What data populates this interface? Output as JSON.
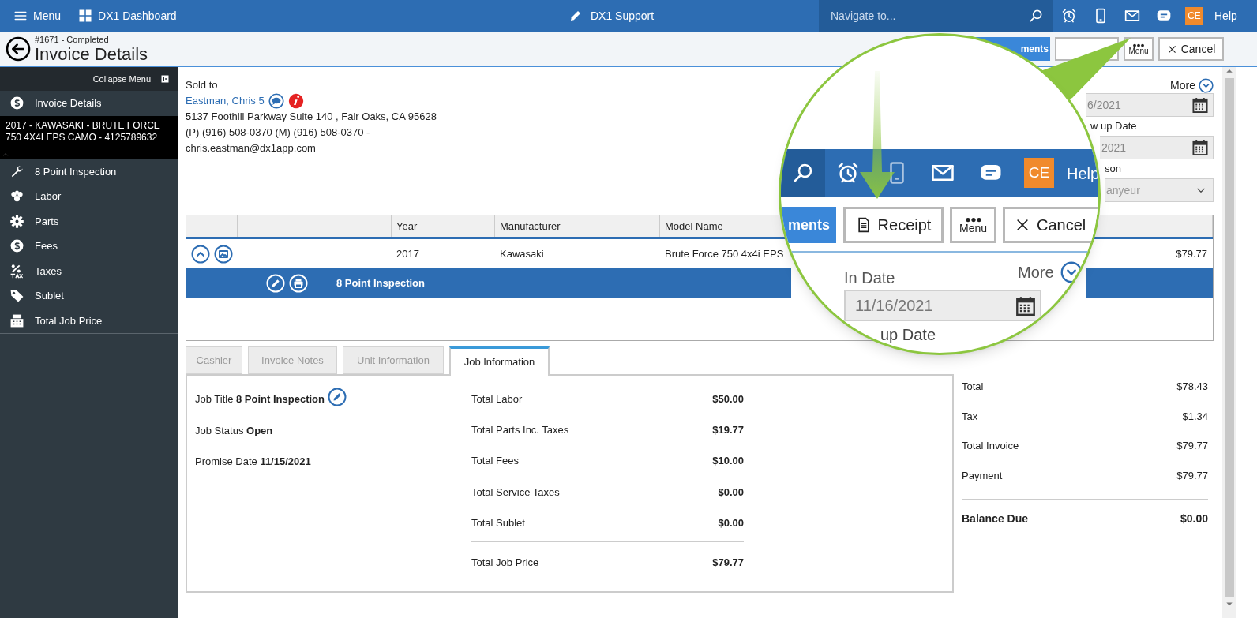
{
  "top_bar": {
    "menu_label": "Menu",
    "dashboard_label": "DX1 Dashboard",
    "center_title": "DX1 Support",
    "search": {
      "placeholder": "Navigate to..."
    },
    "avatar": "CE",
    "help": "Help"
  },
  "header": {
    "status": "#1671 - Completed",
    "title": "Invoice Details",
    "buttons": [
      {
        "kind": "primary",
        "label": "ments"
      },
      {
        "kind": "covered"
      },
      {
        "kind": "menu",
        "label": "Menu"
      },
      {
        "kind": "cancel",
        "label": "Cancel"
      }
    ]
  },
  "sidebar": {
    "collapse_label": "Collapse Menu",
    "items": [
      {
        "kind": "nav",
        "label": "Invoice Details"
      },
      {
        "kind": "unit",
        "label": "2017 - KAWASAKI - BRUTE FORCE 750 4X4I EPS CAMO - 4125789632"
      },
      {
        "kind": "nav",
        "label": "8 Point Inspection"
      },
      {
        "kind": "nav",
        "label": "Labor"
      },
      {
        "kind": "nav",
        "label": "Parts"
      },
      {
        "kind": "nav",
        "label": "Fees"
      },
      {
        "kind": "nav",
        "label": "Taxes"
      },
      {
        "kind": "nav",
        "label": "Sublet"
      },
      {
        "kind": "nav",
        "label": "Total Job Price"
      }
    ]
  },
  "sold_to": {
    "label": "Sold to",
    "customer": "Eastman, Chris 5",
    "address": "5137 Foothill Parkway Suite 140 , Fair Oaks, CA 95628",
    "phones": "(P) (916) 508-0370 (M) (916) 508-0370 -",
    "email": "chris.eastman@dx1app.com"
  },
  "details_panel": {
    "more": "More",
    "fields": [
      {
        "kind": "date",
        "value": "6/2021"
      },
      {
        "kind": "label",
        "text": "w up Date"
      },
      {
        "kind": "date",
        "value": "2021"
      },
      {
        "kind": "label",
        "text": "son"
      },
      {
        "kind": "select",
        "value": "anyeur"
      }
    ]
  },
  "unit_table": {
    "columns": [
      {
        "label": "Year"
      },
      {
        "label": "Manufacturer"
      },
      {
        "label": "Model Name"
      }
    ],
    "rows": [
      {
        "expanded": true,
        "year": "2017",
        "manufacturer": "Kawasaki",
        "model_name": "Brute Force 750 4x4i EPS",
        "column_6": "$79.77",
        "jobs": [
          {
            "label": "8 Point Inspection",
            "selected": true
          }
        ]
      }
    ]
  },
  "tabs": [
    {
      "label": "Cashier",
      "selected": false
    },
    {
      "label": "Invoice Notes",
      "selected": false
    },
    {
      "label": "Unit Information",
      "selected": false
    },
    {
      "label": "Job Information",
      "selected": true
    }
  ],
  "job_information": {
    "fields": [
      {
        "label": "Job Title",
        "value": "8 Point Inspection",
        "editable": true
      },
      {
        "label": "Job Status",
        "value": "Open",
        "editable": false
      },
      {
        "label": "Promise Date",
        "value": "11/15/2021",
        "editable": false
      }
    ],
    "totals": [
      {
        "label": "Total Labor",
        "value": "$50.00"
      },
      {
        "label": "Total Parts Inc. Taxes",
        "value": "$19.77"
      },
      {
        "label": "Total Fees",
        "value": "$10.00"
      },
      {
        "label": "Total Service Taxes",
        "value": "$0.00"
      },
      {
        "label": "Total Sublet",
        "value": "$0.00"
      }
    ],
    "total_job_price": {
      "label": "Total Job Price",
      "value": "$79.77"
    }
  },
  "summary": {
    "rows": [
      {
        "label": "Total",
        "value": "$78.43"
      },
      {
        "label": "Tax",
        "value": "$1.34"
      },
      {
        "label": "Total Invoice",
        "value": "$79.77"
      },
      {
        "label": "Payment",
        "value": "$79.77"
      }
    ],
    "balance_due": {
      "label": "Balance Due",
      "value": "$0.00"
    }
  },
  "magnifier": {
    "avatar": "CE",
    "help": "Help",
    "buttons": [
      {
        "kind": "primary",
        "label": "ments"
      },
      {
        "kind": "receipt",
        "label": "Receipt"
      },
      {
        "kind": "menu",
        "label": "Menu"
      },
      {
        "kind": "cancel",
        "label": "Cancel"
      }
    ],
    "in_date": {
      "label": "In Date",
      "value": "11/16/2021"
    },
    "more": "More",
    "next_label": "up Date"
  }
}
